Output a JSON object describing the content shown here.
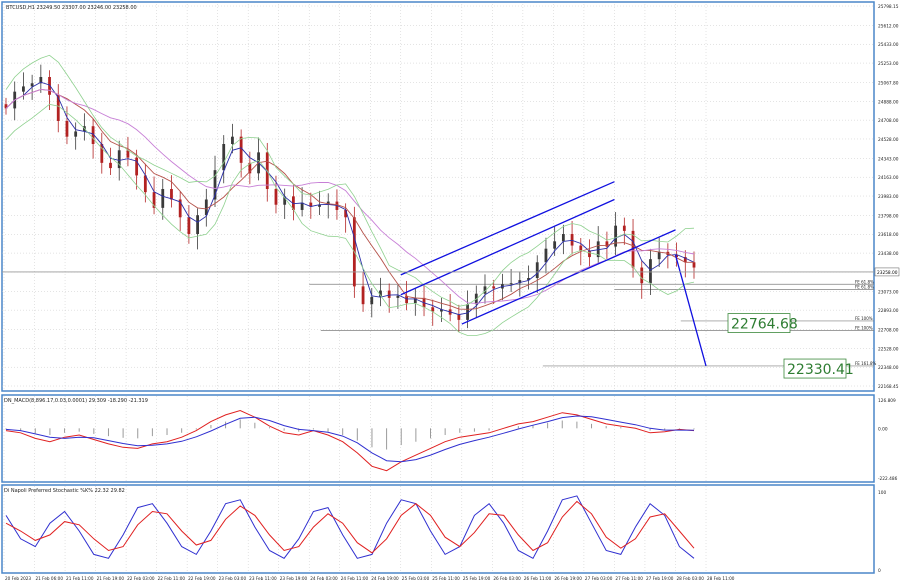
{
  "chart_data": {
    "type": "candlestick",
    "symbol_header": "BTCUSD,H1  23249.50 23307.00 23246.00 23258.00",
    "x_tick_labels": [
      "20 Feb 2023",
      "21 Feb 06:00",
      "21 Feb 11:00",
      "21 Feb 19:00",
      "22 Feb 03:00",
      "22 Feb 11:00",
      "22 Feb 19:00",
      "23 Feb 03:00",
      "23 Feb 11:00",
      "23 Feb 19:00",
      "24 Feb 03:00",
      "24 Feb 11:00",
      "24 Feb 19:00",
      "25 Feb 03:00",
      "25 Feb 11:00",
      "25 Feb 19:00",
      "26 Feb 03:00",
      "26 Feb 11:00",
      "26 Feb 19:00",
      "27 Feb 03:00",
      "27 Feb 11:00",
      "27 Feb 19:00",
      "28 Feb 03:00",
      "28 Feb 11:00"
    ],
    "price_axis": {
      "min": 22168.45,
      "max": 25798.15,
      "tick_labels": [
        "25798.15",
        "25612.00",
        "25433.00",
        "25253.00",
        "25067.80",
        "24888.00",
        "24708.00",
        "24528.00",
        "24343.00",
        "24163.00",
        "23983.00",
        "23798.00",
        "23618.00",
        "23438.00",
        "23258.00",
        "23073.00",
        "22893.00",
        "22708.00",
        "22528.00",
        "22348.00",
        "22168.45"
      ],
      "current_price": "23258.00"
    },
    "close_series": [
      24820,
      24980,
      25030,
      25060,
      25120,
      24950,
      24700,
      24550,
      24600,
      24650,
      24480,
      24300,
      24250,
      24420,
      24350,
      24180,
      24020,
      23870,
      24050,
      23950,
      23780,
      23620,
      23800,
      23950,
      24230,
      24480,
      24550,
      24300,
      24200,
      24400,
      24050,
      23900,
      23980,
      23850,
      23920,
      23880,
      23900,
      23930,
      23850,
      23780,
      23120,
      22950,
      23020,
      23080,
      23010,
      23030,
      22960,
      23010,
      22920,
      22880,
      22900,
      22850,
      22800,
      22950,
      23050,
      23120,
      23100,
      23140,
      23150,
      23180,
      23200,
      23350,
      23480,
      23550,
      23620,
      23510,
      23460,
      23400,
      23550,
      23500,
      23700,
      23650,
      23300,
      23150,
      23380,
      23450,
      23420,
      23400,
      23350,
      23300
    ],
    "channel_lines": [
      {
        "from": [
          "25 Feb 03:00",
          23230
        ],
        "to": [
          "27 Feb 11:00",
          24120
        ]
      },
      {
        "from": [
          "25 Feb 03:00",
          23040
        ],
        "to": [
          "27 Feb 11:00",
          23950
        ]
      },
      {
        "from": [
          "25 Feb 19:00",
          22760
        ],
        "to": [
          "28 Feb 03:00",
          23660
        ]
      }
    ],
    "projection_line": {
      "from": [
        "28 Feb 03:00",
        23420
      ],
      "to": [
        "28 Feb 11:00",
        22360
      ]
    },
    "fe_levels": [
      {
        "label": "FE 61.8%",
        "price": 23140
      },
      {
        "label": "FE 61.8%",
        "price": 23090
      },
      {
        "label": "FE 100%",
        "price": 22790
      },
      {
        "label": "FE 100%",
        "price": 22700
      },
      {
        "label": "FE 161.8%",
        "price": 22360
      }
    ],
    "target_labels": [
      {
        "text": "22764.68",
        "price": 22764.68
      },
      {
        "text": "22330.41",
        "price": 22330.41
      }
    ],
    "macd": {
      "title": "DN_MACD(8,896.17,0.03,0.0001)  29.309 -18.290 -21.319",
      "tick_labels": [
        "126.809",
        "0.00",
        "-222.486"
      ],
      "range": [
        -222.486,
        126.809
      ],
      "main": [
        -10,
        -20,
        -45,
        -60,
        -40,
        -30,
        -50,
        -70,
        -85,
        -90,
        -70,
        -60,
        -40,
        -10,
        30,
        60,
        80,
        50,
        10,
        -20,
        -30,
        -10,
        -30,
        -60,
        -110,
        -170,
        -190,
        -150,
        -120,
        -90,
        -60,
        -40,
        -30,
        -20,
        0,
        20,
        30,
        50,
        70,
        60,
        40,
        20,
        10,
        0,
        -20,
        -15,
        -5,
        -10
      ],
      "signal": [
        -5,
        -10,
        -25,
        -40,
        -45,
        -40,
        -42,
        -55,
        -68,
        -78,
        -76,
        -70,
        -58,
        -38,
        -12,
        18,
        45,
        50,
        35,
        12,
        -5,
        -10,
        -18,
        -35,
        -65,
        -110,
        -145,
        -150,
        -140,
        -120,
        -95,
        -72,
        -55,
        -40,
        -22,
        -3,
        14,
        30,
        48,
        55,
        52,
        40,
        28,
        16,
        0,
        -8,
        -8,
        -9
      ]
    },
    "stochastic": {
      "title": "Di Napoli Preferred Stochastic %K%  22.32 29.82",
      "tick_labels": [
        "100",
        "0"
      ],
      "range": [
        0,
        100
      ],
      "k": [
        70,
        40,
        30,
        60,
        75,
        50,
        20,
        15,
        45,
        80,
        85,
        60,
        30,
        20,
        50,
        85,
        90,
        55,
        25,
        15,
        40,
        75,
        80,
        45,
        15,
        20,
        60,
        90,
        85,
        50,
        20,
        30,
        70,
        85,
        60,
        25,
        15,
        50,
        90,
        95,
        60,
        25,
        20,
        55,
        85,
        70,
        30,
        15
      ],
      "d": [
        60,
        50,
        38,
        45,
        62,
        58,
        40,
        25,
        30,
        58,
        75,
        72,
        50,
        32,
        38,
        65,
        82,
        70,
        45,
        25,
        30,
        55,
        72,
        60,
        35,
        22,
        40,
        70,
        85,
        70,
        42,
        30,
        48,
        72,
        70,
        45,
        25,
        35,
        68,
        88,
        72,
        42,
        28,
        40,
        68,
        72,
        50,
        28
      ]
    }
  }
}
